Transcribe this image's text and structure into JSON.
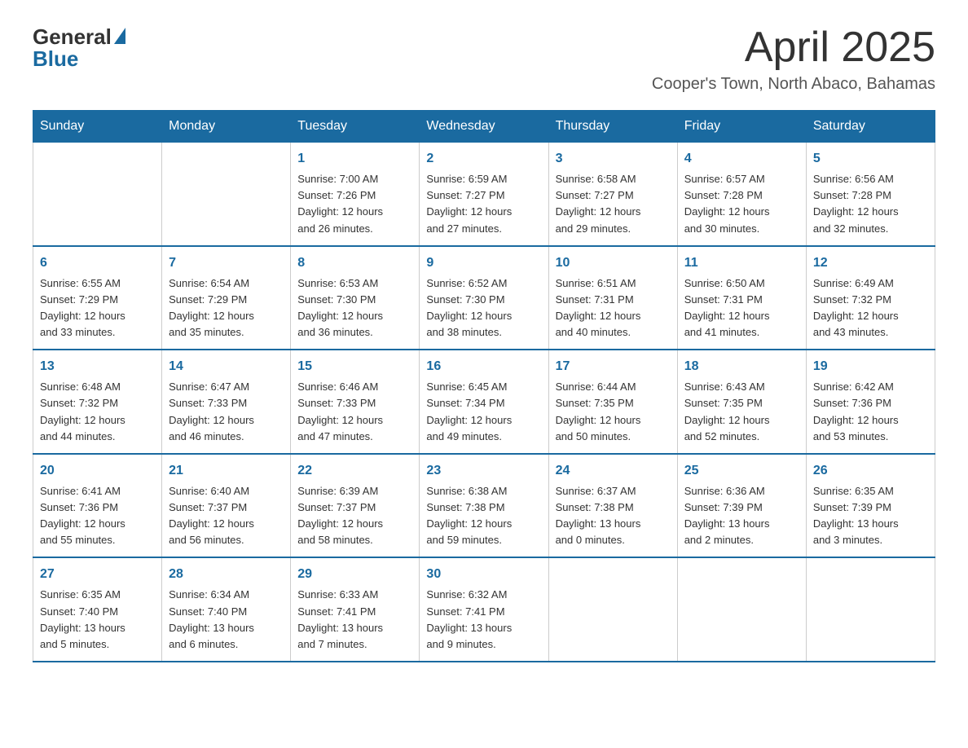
{
  "header": {
    "logo_general": "General",
    "logo_blue": "Blue",
    "month_title": "April 2025",
    "location": "Cooper's Town, North Abaco, Bahamas"
  },
  "days_of_week": [
    "Sunday",
    "Monday",
    "Tuesday",
    "Wednesday",
    "Thursday",
    "Friday",
    "Saturday"
  ],
  "weeks": [
    [
      {
        "day": "",
        "info": ""
      },
      {
        "day": "",
        "info": ""
      },
      {
        "day": "1",
        "info": "Sunrise: 7:00 AM\nSunset: 7:26 PM\nDaylight: 12 hours\nand 26 minutes."
      },
      {
        "day": "2",
        "info": "Sunrise: 6:59 AM\nSunset: 7:27 PM\nDaylight: 12 hours\nand 27 minutes."
      },
      {
        "day": "3",
        "info": "Sunrise: 6:58 AM\nSunset: 7:27 PM\nDaylight: 12 hours\nand 29 minutes."
      },
      {
        "day": "4",
        "info": "Sunrise: 6:57 AM\nSunset: 7:28 PM\nDaylight: 12 hours\nand 30 minutes."
      },
      {
        "day": "5",
        "info": "Sunrise: 6:56 AM\nSunset: 7:28 PM\nDaylight: 12 hours\nand 32 minutes."
      }
    ],
    [
      {
        "day": "6",
        "info": "Sunrise: 6:55 AM\nSunset: 7:29 PM\nDaylight: 12 hours\nand 33 minutes."
      },
      {
        "day": "7",
        "info": "Sunrise: 6:54 AM\nSunset: 7:29 PM\nDaylight: 12 hours\nand 35 minutes."
      },
      {
        "day": "8",
        "info": "Sunrise: 6:53 AM\nSunset: 7:30 PM\nDaylight: 12 hours\nand 36 minutes."
      },
      {
        "day": "9",
        "info": "Sunrise: 6:52 AM\nSunset: 7:30 PM\nDaylight: 12 hours\nand 38 minutes."
      },
      {
        "day": "10",
        "info": "Sunrise: 6:51 AM\nSunset: 7:31 PM\nDaylight: 12 hours\nand 40 minutes."
      },
      {
        "day": "11",
        "info": "Sunrise: 6:50 AM\nSunset: 7:31 PM\nDaylight: 12 hours\nand 41 minutes."
      },
      {
        "day": "12",
        "info": "Sunrise: 6:49 AM\nSunset: 7:32 PM\nDaylight: 12 hours\nand 43 minutes."
      }
    ],
    [
      {
        "day": "13",
        "info": "Sunrise: 6:48 AM\nSunset: 7:32 PM\nDaylight: 12 hours\nand 44 minutes."
      },
      {
        "day": "14",
        "info": "Sunrise: 6:47 AM\nSunset: 7:33 PM\nDaylight: 12 hours\nand 46 minutes."
      },
      {
        "day": "15",
        "info": "Sunrise: 6:46 AM\nSunset: 7:33 PM\nDaylight: 12 hours\nand 47 minutes."
      },
      {
        "day": "16",
        "info": "Sunrise: 6:45 AM\nSunset: 7:34 PM\nDaylight: 12 hours\nand 49 minutes."
      },
      {
        "day": "17",
        "info": "Sunrise: 6:44 AM\nSunset: 7:35 PM\nDaylight: 12 hours\nand 50 minutes."
      },
      {
        "day": "18",
        "info": "Sunrise: 6:43 AM\nSunset: 7:35 PM\nDaylight: 12 hours\nand 52 minutes."
      },
      {
        "day": "19",
        "info": "Sunrise: 6:42 AM\nSunset: 7:36 PM\nDaylight: 12 hours\nand 53 minutes."
      }
    ],
    [
      {
        "day": "20",
        "info": "Sunrise: 6:41 AM\nSunset: 7:36 PM\nDaylight: 12 hours\nand 55 minutes."
      },
      {
        "day": "21",
        "info": "Sunrise: 6:40 AM\nSunset: 7:37 PM\nDaylight: 12 hours\nand 56 minutes."
      },
      {
        "day": "22",
        "info": "Sunrise: 6:39 AM\nSunset: 7:37 PM\nDaylight: 12 hours\nand 58 minutes."
      },
      {
        "day": "23",
        "info": "Sunrise: 6:38 AM\nSunset: 7:38 PM\nDaylight: 12 hours\nand 59 minutes."
      },
      {
        "day": "24",
        "info": "Sunrise: 6:37 AM\nSunset: 7:38 PM\nDaylight: 13 hours\nand 0 minutes."
      },
      {
        "day": "25",
        "info": "Sunrise: 6:36 AM\nSunset: 7:39 PM\nDaylight: 13 hours\nand 2 minutes."
      },
      {
        "day": "26",
        "info": "Sunrise: 6:35 AM\nSunset: 7:39 PM\nDaylight: 13 hours\nand 3 minutes."
      }
    ],
    [
      {
        "day": "27",
        "info": "Sunrise: 6:35 AM\nSunset: 7:40 PM\nDaylight: 13 hours\nand 5 minutes."
      },
      {
        "day": "28",
        "info": "Sunrise: 6:34 AM\nSunset: 7:40 PM\nDaylight: 13 hours\nand 6 minutes."
      },
      {
        "day": "29",
        "info": "Sunrise: 6:33 AM\nSunset: 7:41 PM\nDaylight: 13 hours\nand 7 minutes."
      },
      {
        "day": "30",
        "info": "Sunrise: 6:32 AM\nSunset: 7:41 PM\nDaylight: 13 hours\nand 9 minutes."
      },
      {
        "day": "",
        "info": ""
      },
      {
        "day": "",
        "info": ""
      },
      {
        "day": "",
        "info": ""
      }
    ]
  ],
  "accent_color": "#1a6aa0"
}
